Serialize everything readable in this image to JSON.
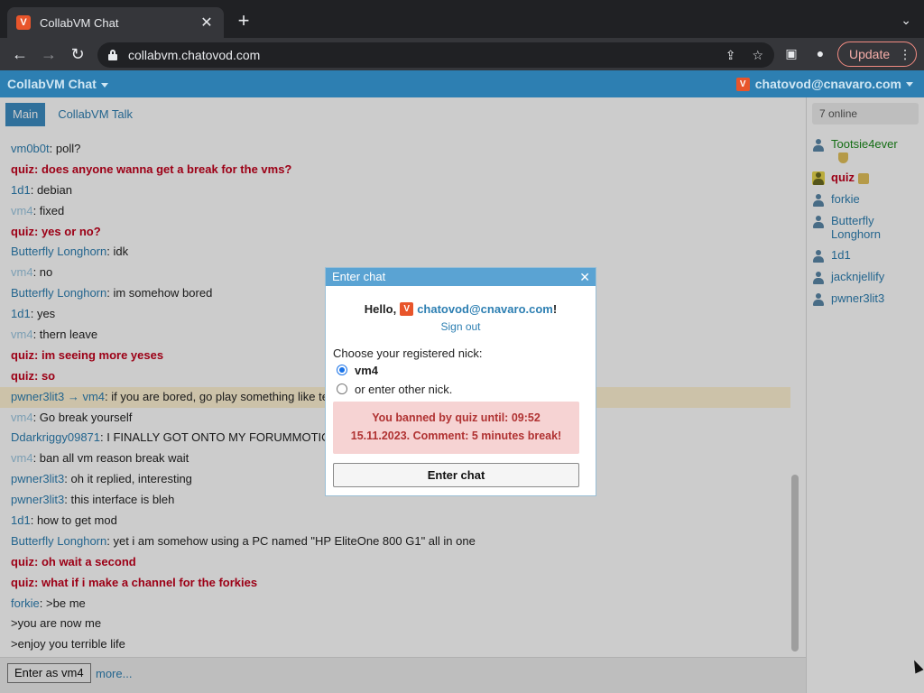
{
  "browser": {
    "tab_title": "CollabVM Chat",
    "favicon_letter": "V",
    "url": "collabvm.chatovod.com",
    "update_label": "Update"
  },
  "header": {
    "app_title": "CollabVM Chat",
    "user": "chatovod@cnavaro.com"
  },
  "tabs": [
    {
      "label": "Main",
      "active": true
    },
    {
      "label": "CollabVM Talk",
      "active": false
    }
  ],
  "messages": [
    {
      "nick": "vm0b0t",
      "sep": ": ",
      "text": "poll?"
    },
    {
      "nick": "quiz",
      "sep": ": ",
      "text": "does anyone wanna get a break for the vms?"
    },
    {
      "nick": "1d1",
      "sep": ": ",
      "text": "debian"
    },
    {
      "nick": "vm4",
      "sep": ": ",
      "text": "fixed"
    },
    {
      "nick": "quiz",
      "sep": ": ",
      "text": "yes or no?"
    },
    {
      "nick": "Butterfly Longhorn",
      "sep": ": ",
      "text": "idk"
    },
    {
      "nick": "vm4",
      "sep": ": ",
      "text": "no"
    },
    {
      "nick": "Butterfly Longhorn",
      "sep": ": ",
      "text": "im somehow bored"
    },
    {
      "nick": "1d1",
      "sep": ": ",
      "text": "yes"
    },
    {
      "nick": "vm4",
      "sep": ": ",
      "text": "thern leave"
    },
    {
      "nick": "quiz",
      "sep": ": ",
      "text": "im seeing more yeses"
    },
    {
      "nick": "quiz",
      "sep": ": ",
      "text": "so"
    },
    {
      "nick": "pwner3lit3 → vm4",
      "sep": ": ",
      "text": "if you are bored, go play something like te"
    },
    {
      "nick": "vm4",
      "sep": ": ",
      "text": "Go break yourself"
    },
    {
      "nick": "Ddarkriggy09871",
      "sep": ": ",
      "text": "I FINALLY GOT ONTO MY FORUMMOTIO"
    },
    {
      "nick": "vm4",
      "sep": ": ",
      "text": "ban all vm reason break wait"
    },
    {
      "nick": "pwner3lit3",
      "sep": ": ",
      "text": "oh it replied, interesting"
    },
    {
      "nick": "pwner3lit3",
      "sep": ": ",
      "text": "this interface is bleh"
    },
    {
      "nick": "1d1",
      "sep": ": ",
      "text": "how to get mod"
    },
    {
      "nick": "Butterfly Longhorn",
      "sep": ": ",
      "text": "yet i am somehow using a PC named \"HP EliteOne 800 G1\" all in one"
    },
    {
      "nick": "quiz",
      "sep": ": ",
      "text": "oh wait a second"
    },
    {
      "nick": "quiz",
      "sep": ": ",
      "text": "what if i make a channel for the forkies"
    },
    {
      "nick": "forkie",
      "sep": ": ",
      "text": ">be me"
    },
    {
      "nick": "",
      "sep": "",
      "text": ">you are now me"
    },
    {
      "nick": "",
      "sep": "",
      "text": ">enjoy you terrible life"
    }
  ],
  "footer": {
    "enter_as": "Enter as vm4",
    "more": "more..."
  },
  "sidebar": {
    "online": "7 online",
    "users": [
      {
        "name": "Tootsie4ever",
        "style": "green",
        "badge": "shield"
      },
      {
        "name": "quiz",
        "style": "red",
        "badge": "crown"
      },
      {
        "name": "forkie",
        "style": "",
        "badge": ""
      },
      {
        "name": "Butterfly Longhorn",
        "style": "",
        "badge": ""
      },
      {
        "name": "1d1",
        "style": "",
        "badge": ""
      },
      {
        "name": "jacknjellify",
        "style": "",
        "badge": ""
      },
      {
        "name": "pwner3lit3",
        "style": "",
        "badge": ""
      }
    ]
  },
  "modal": {
    "title": "Enter chat",
    "hello": "Hello,",
    "account": "chatovod@cnavaro.com",
    "exclam": "!",
    "signout": "Sign out",
    "choose": "Choose your registered nick:",
    "options": [
      "vm4",
      "or enter other nick."
    ],
    "ban_line1": "You banned by quiz until: 09:52",
    "ban_line2": "15.11.2023. Comment: 5 minutes break!",
    "enter_button": "Enter chat"
  },
  "colors": {
    "header_blue": "#2d7fb2",
    "red_nick": "#c4001c",
    "ban_bg": "#f6d3d3"
  }
}
